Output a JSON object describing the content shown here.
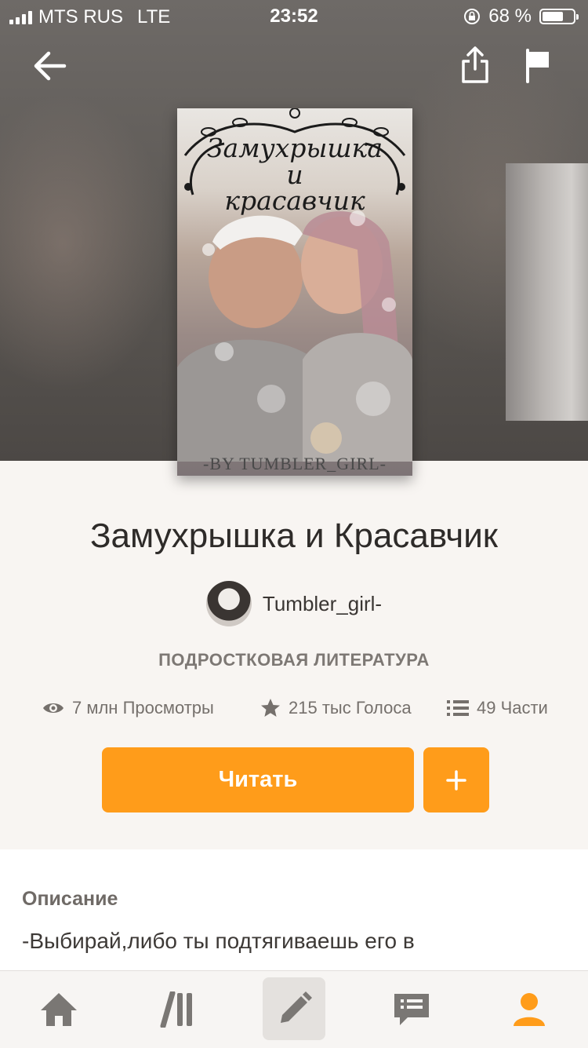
{
  "status_bar": {
    "carrier": "MTS RUS",
    "network": "LTE",
    "time": "23:52",
    "battery": "68 %",
    "battery_level": 0.68
  },
  "header": {
    "back_icon": "arrow-left-icon",
    "share_icon": "share-icon",
    "report_icon": "flag-icon"
  },
  "cover": {
    "title_line1": "Замухрышка",
    "title_line2": "и",
    "title_line3": "красавчик",
    "author_signature": "-BY TUMBLER_GIRL-"
  },
  "book": {
    "title": "Замухрышка и Красавчик",
    "author": "Tumbler_girl-",
    "genre": "ПОДРОСТКОВАЯ ЛИТЕРАТУРА"
  },
  "stats": {
    "views": "7 млн Просмотры",
    "votes": "215 тыс Голоса",
    "parts": "49 Части"
  },
  "actions": {
    "read_label": "Читать",
    "add_label": "+"
  },
  "description": {
    "label": "Описание",
    "text": "-Выбирай,либо ты подтягиваешь его в"
  },
  "tabbar": {
    "active_color": "#ff9c1a",
    "inactive_color": "#7a7774",
    "items": [
      "home-icon",
      "library-icon",
      "write-icon",
      "messages-icon",
      "profile-icon"
    ]
  },
  "accent_color": "#ff9c1a"
}
